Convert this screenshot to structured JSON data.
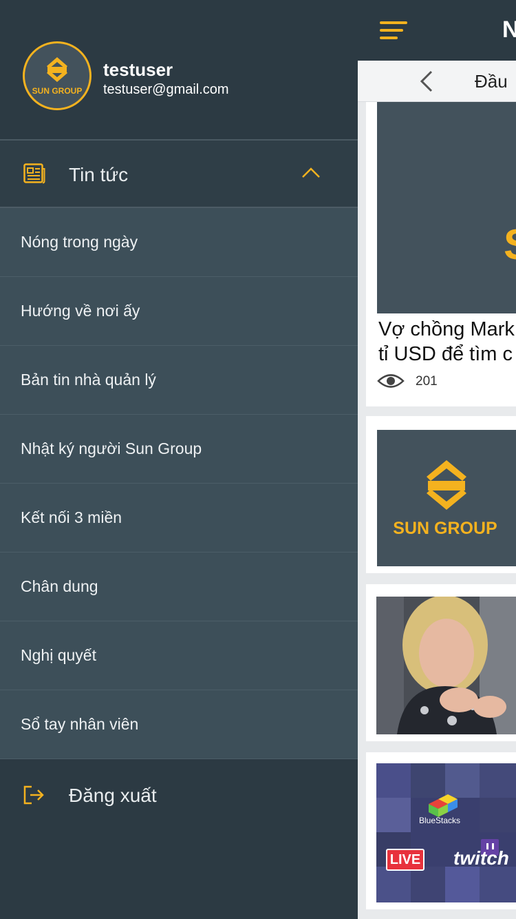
{
  "profile": {
    "username": "testuser",
    "email": "testuser@gmail.com",
    "logo_text": "SUN GROUP"
  },
  "menu": {
    "section_label": "Tin tức",
    "section_icon": "newspaper-icon",
    "expanded": true,
    "items": [
      {
        "label": "Nóng trong ngày"
      },
      {
        "label": "Hướng về nơi ấy"
      },
      {
        "label": "Bản tin nhà quản lý"
      },
      {
        "label": "Nhật ký người Sun Group"
      },
      {
        "label": "Kết nối 3 miền"
      },
      {
        "label": "Chân dung"
      },
      {
        "label": "Nghị quyết"
      },
      {
        "label": "Sổ tay nhân viên"
      }
    ],
    "logout_label": "Đăng xuất",
    "logout_icon": "logout-icon"
  },
  "main": {
    "title": "N",
    "subtitle": "Đầu",
    "articles": [
      {
        "headline_line1": "Vợ chồng Mark",
        "headline_line2": "tỉ USD để tìm c",
        "views": "201",
        "image_text": "S"
      },
      {
        "logo_text": "SUN GROUP"
      },
      {
        "image": "photo-woman"
      },
      {
        "bluestacks_label": "BlueStacks",
        "live_label": "LIVE",
        "twitch_label": "twitch"
      }
    ]
  },
  "colors": {
    "accent": "#f4b21f",
    "drawer_bg": "#2c3a43",
    "submenu_bg": "#3d4f59"
  }
}
